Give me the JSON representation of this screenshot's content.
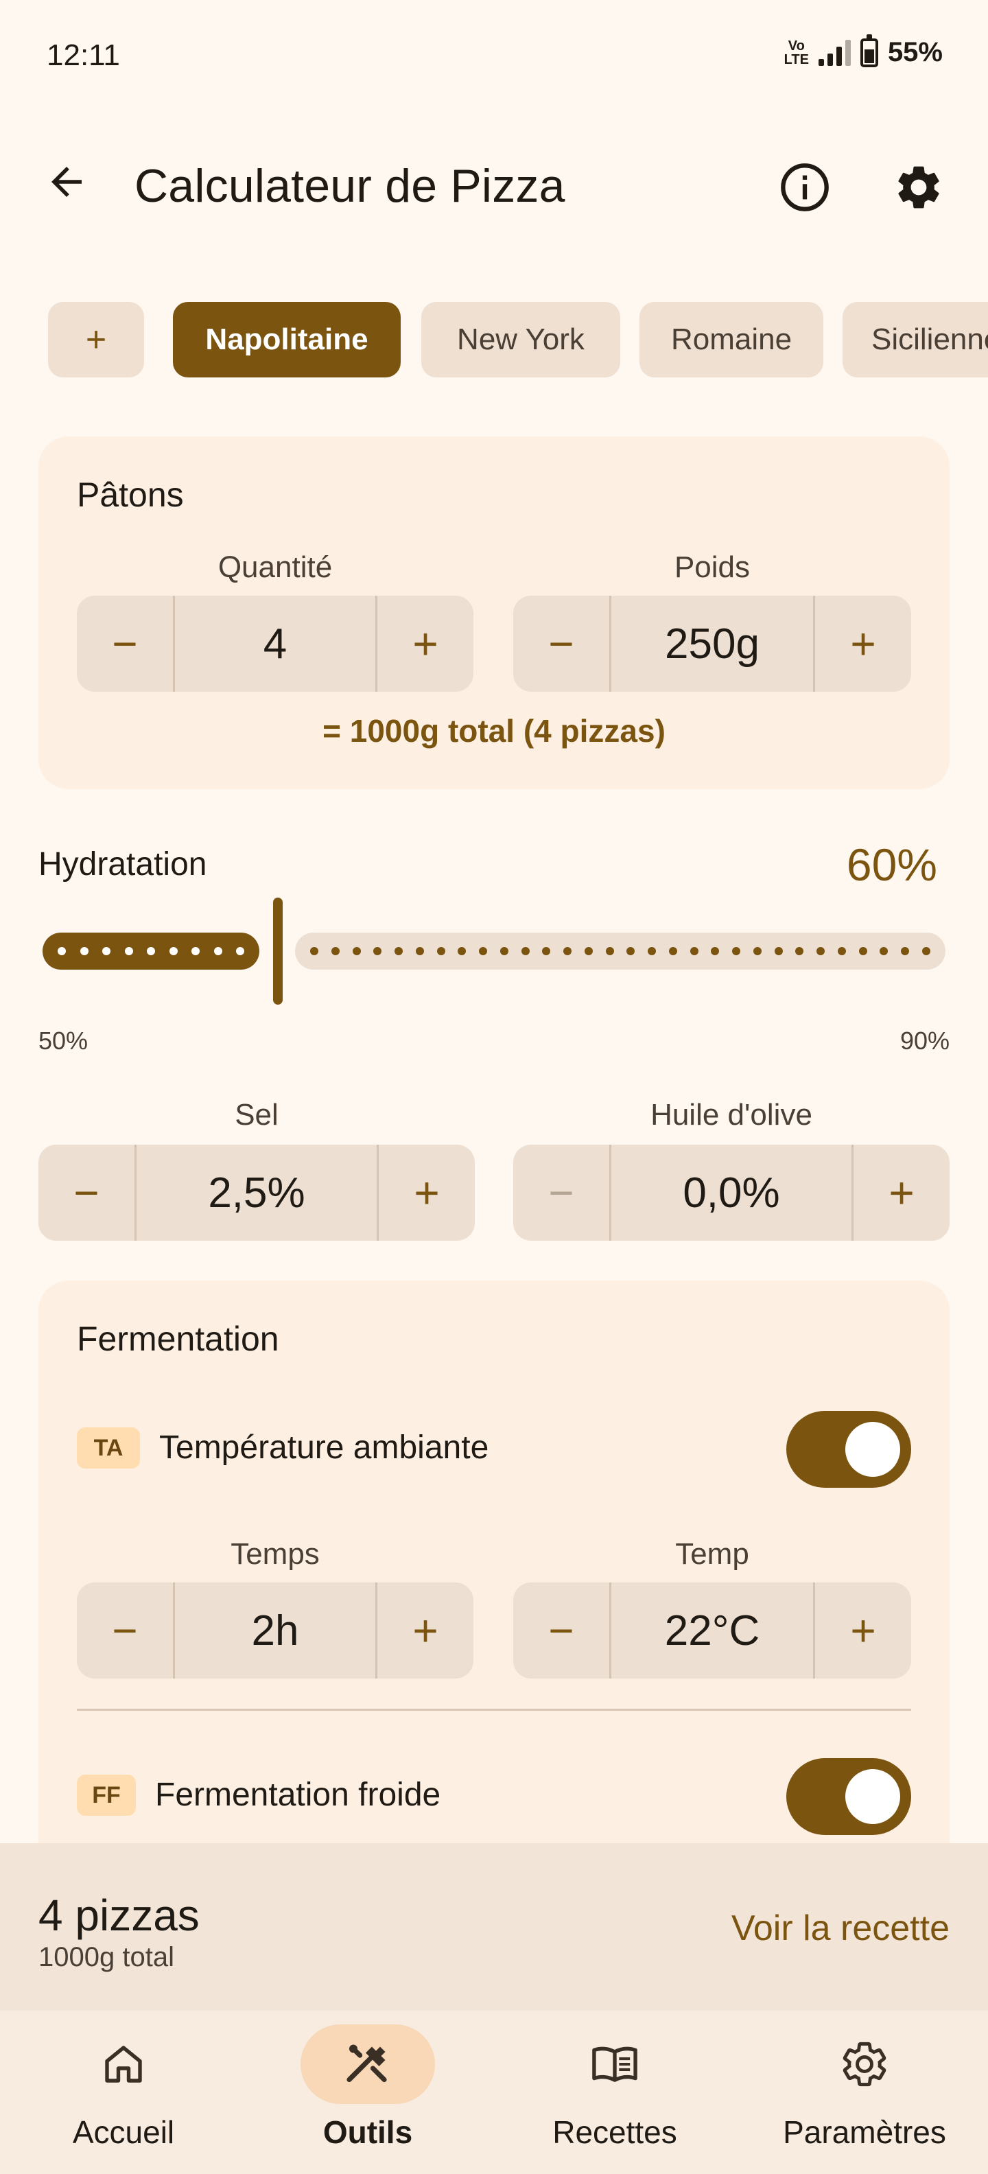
{
  "status_bar": {
    "time": "12:11",
    "volte_top": "Vo",
    "volte_bottom": "LTE",
    "battery": "55%"
  },
  "app_bar": {
    "back_icon": "arrow-back-icon",
    "title": "Calculateur de Pizza",
    "info_icon": "info-icon",
    "settings_icon": "gear-icon"
  },
  "styles": {
    "add_label": "+",
    "chips": [
      {
        "label": "Napolitaine",
        "selected": true
      },
      {
        "label": "New York",
        "selected": false
      },
      {
        "label": "Romaine",
        "selected": false
      },
      {
        "label": "Sicilienne",
        "selected": false
      }
    ]
  },
  "patons": {
    "title": "Pâtons",
    "quantity": {
      "label": "Quantité",
      "value": "4",
      "minus": "−",
      "plus": "+"
    },
    "weight": {
      "label": "Poids",
      "value": "250g",
      "minus": "−",
      "plus": "+"
    },
    "summary": "= 1000g total (4 pizzas)"
  },
  "hydration": {
    "label": "Hydratation",
    "value": "60%",
    "value_percent": 60,
    "min": "50%",
    "max": "90%"
  },
  "salt": {
    "label": "Sel",
    "value": "2,5%",
    "minus": "−",
    "plus": "+"
  },
  "oil": {
    "label": "Huile d'olive",
    "value": "0,0%",
    "minus": "−",
    "plus": "+",
    "minus_disabled": true
  },
  "fermentation": {
    "title": "Fermentation",
    "room": {
      "badge": "TA",
      "label": "Température ambiante",
      "enabled": true,
      "time": {
        "label": "Temps",
        "value": "2h",
        "minus": "−",
        "plus": "+"
      },
      "temp": {
        "label": "Temp",
        "value": "22°C",
        "minus": "−",
        "plus": "+"
      }
    },
    "cold": {
      "badge": "FF",
      "label": "Fermentation froide",
      "enabled": true
    }
  },
  "summary_bar": {
    "pizzas": "4 pizzas",
    "total": "1000g total",
    "link": "Voir la recette"
  },
  "bottom_nav": [
    {
      "label": "Accueil",
      "icon": "home-icon",
      "active": false
    },
    {
      "label": "Outils",
      "icon": "tools-icon",
      "active": true
    },
    {
      "label": "Recettes",
      "icon": "book-icon",
      "active": false
    },
    {
      "label": "Paramètres",
      "icon": "gear-icon",
      "active": false
    }
  ],
  "colors": {
    "primary": "#7B5410",
    "background": "#FFF8F1",
    "card": "#FDF0E3",
    "badge": "#FFDDB0"
  }
}
